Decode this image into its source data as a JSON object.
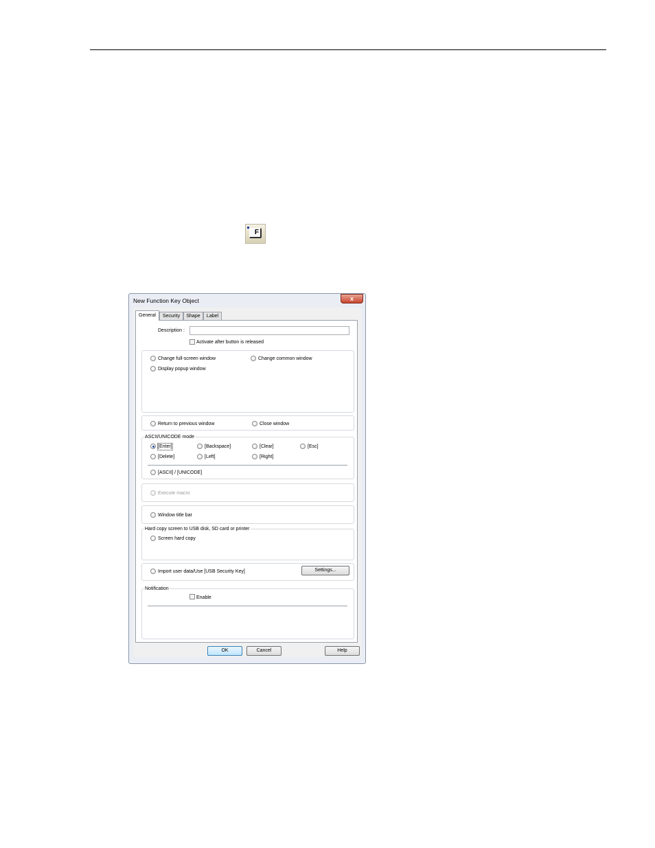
{
  "dialog": {
    "title": "New  Function Key Object",
    "close_label": "x"
  },
  "tabs": [
    {
      "label": "General",
      "active": true
    },
    {
      "label": "Security",
      "active": false
    },
    {
      "label": "Shape",
      "active": false
    },
    {
      "label": "Label",
      "active": false
    }
  ],
  "general": {
    "description_label": "Description :",
    "description_value": "",
    "activate_after_release_label": "Activate after button is released",
    "window_options": {
      "change_fullscreen": "Change full-screen window",
      "change_common": "Change common window",
      "display_popup": "Display popup window"
    },
    "return_previous": "Return to previous window",
    "close_window": "Close window",
    "ascii_group_label": "ASCII/UNICODE mode",
    "keys": {
      "enter": "[Enter]",
      "backspace": "[Backspace]",
      "clear": "[Clear]",
      "esc": "[Esc]",
      "delete": "[Delete]",
      "left": "[Left]",
      "right": "[Right]"
    },
    "selected_key": "[Enter]",
    "ascii_unicode": "[ASCII] / [UNICODE]",
    "execute_macro": "Execute macro",
    "window_title_bar": "Window title bar",
    "hardcopy_group_label": "Hard copy screen to USB disk, SD card or printer",
    "screen_hard_copy": "Screen hard copy",
    "import_user_data": "Import user data/Use [USB Security Key]",
    "settings_button": "Settings...",
    "notification_group_label": "Notification",
    "enable_label": "Enable"
  },
  "footer": {
    "ok": "OK",
    "cancel": "Cancel",
    "help": "Help"
  },
  "colors": {
    "default_button": "#bee6fd",
    "close_button": "#c9452e",
    "selected_radio": "#2a55b8"
  }
}
